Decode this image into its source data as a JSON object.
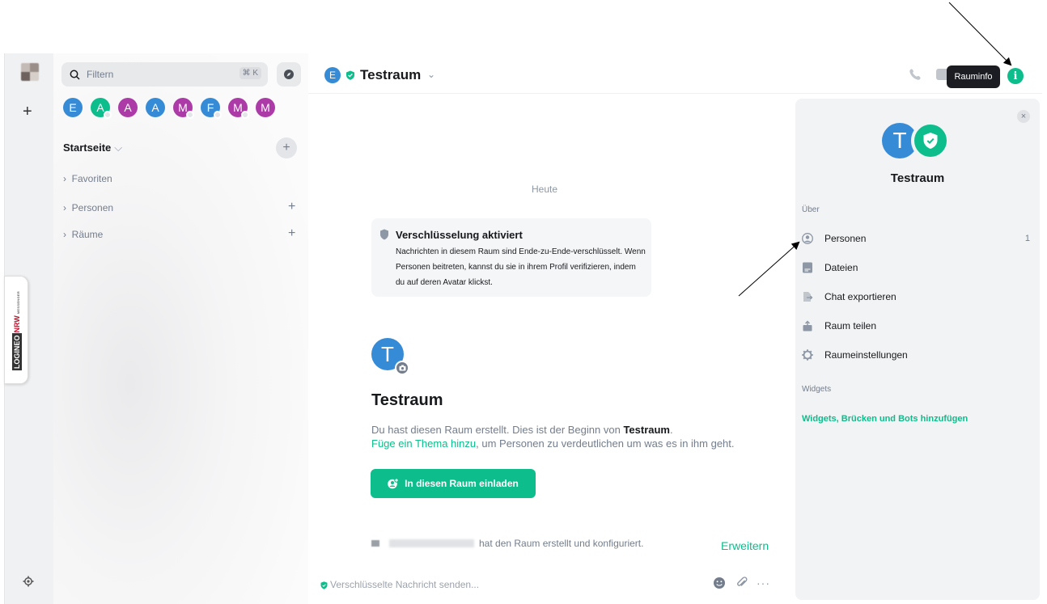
{
  "sidebar": {
    "filter_placeholder": "Filtern",
    "filter_shortcut": "⌘ K",
    "avatars": [
      {
        "letter": "E",
        "color": "#368bd6",
        "badge": false
      },
      {
        "letter": "A",
        "color": "#0dbd8b",
        "badge": true
      },
      {
        "letter": "A",
        "color": "#ac3ba8",
        "badge": false
      },
      {
        "letter": "A",
        "color": "#368bd6",
        "badge": false
      },
      {
        "letter": "M",
        "color": "#ac3ba8",
        "badge": true
      },
      {
        "letter": "F",
        "color": "#368bd6",
        "badge": true
      },
      {
        "letter": "M",
        "color": "#ac3ba8",
        "badge": true
      },
      {
        "letter": "M",
        "color": "#ac3ba8",
        "badge": false
      }
    ],
    "heading": "Startseite",
    "sections": [
      "Favoriten",
      "Personen",
      "Räume"
    ],
    "logineo": {
      "part1": "LOGINEO",
      "part2": "NRW",
      "part3": "MESSENGER"
    }
  },
  "header": {
    "avatar_letter": "E",
    "room_name": "Testraum",
    "tooltip": "Rauminfo",
    "info_glyph": "i"
  },
  "timeline": {
    "day_separator": "Heute",
    "encryption_title": "Verschlüsselung aktiviert",
    "encryption_body": "Nachrichten in diesem Raum sind Ende-zu-Ende-verschlüsselt. Wenn Personen beitreten, kannst du sie in ihrem Profil verifizieren, indem du auf deren Avatar klickst.",
    "avatar_letter": "T",
    "intro_title": "Testraum",
    "intro_line1_prefix": "Du hast diesen Raum erstellt. Dies ist der Beginn von ",
    "intro_line1_bold": "Testraum",
    "intro_line1_suffix": ".",
    "intro_line2_link": "Füge ein Thema hinzu",
    "intro_line2_rest": ", um Personen zu verdeutlichen um was es in ihm geht.",
    "invite_button": "In diesen Raum einladen",
    "created_text": "hat den Raum erstellt und konfiguriert.",
    "expand_link": "Erweitern"
  },
  "composer": {
    "placeholder": "Verschlüsselte Nachricht senden..."
  },
  "panel": {
    "avatar_letter": "T",
    "title": "Testraum",
    "about_label": "Über",
    "items": [
      {
        "label": "Personen",
        "count": "1"
      },
      {
        "label": "Dateien"
      },
      {
        "label": "Chat exportieren"
      },
      {
        "label": "Raum teilen"
      },
      {
        "label": "Raumeinstellungen"
      }
    ],
    "widgets_label": "Widgets",
    "widgets_link": "Widgets, Brücken und Bots hinzufügen",
    "close_glyph": "×"
  },
  "colors": {
    "accent": "#0dbd8b",
    "blue": "#368bd6",
    "purple": "#ac3ba8"
  }
}
